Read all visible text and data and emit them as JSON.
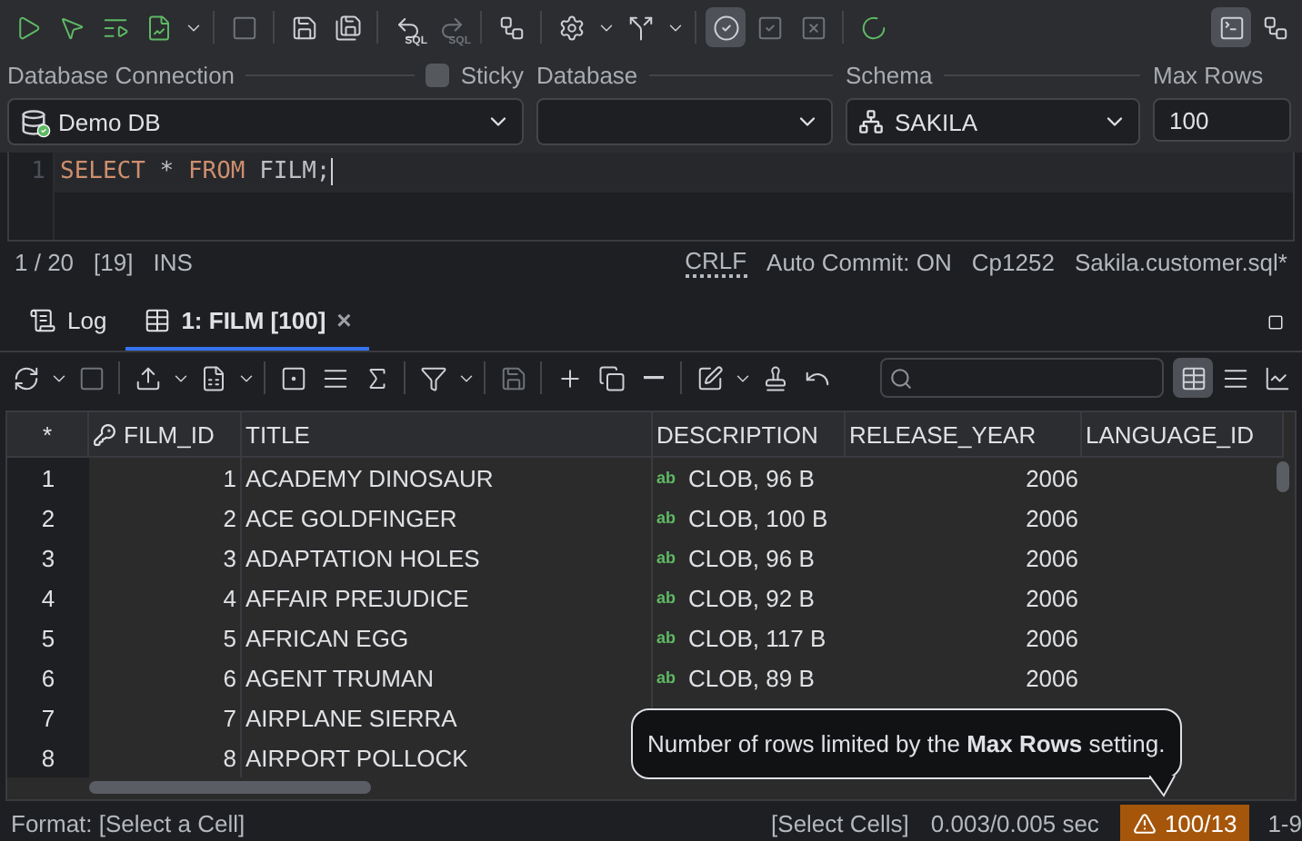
{
  "main_toolbar": [
    {
      "kind": "run",
      "selected": false,
      "disabled": false
    },
    {
      "kind": "runcursor",
      "selected": false,
      "disabled": false
    },
    {
      "kind": "runscript",
      "selected": false,
      "disabled": false
    },
    {
      "kind": "runplan",
      "selected": false,
      "disabled": false
    },
    {
      "kind": "dropdown",
      "selected": false,
      "disabled": false
    },
    {
      "kind": "sep"
    },
    {
      "kind": "stop",
      "selected": false,
      "disabled": true
    },
    {
      "kind": "sep"
    },
    {
      "kind": "save",
      "selected": false,
      "disabled": false
    },
    {
      "kind": "saveall",
      "selected": false,
      "disabled": false
    },
    {
      "kind": "sep"
    },
    {
      "kind": "undosql",
      "label": "SQL",
      "selected": false,
      "disabled": false
    },
    {
      "kind": "redosql",
      "label": "SQL",
      "selected": false,
      "disabled": true
    },
    {
      "kind": "sep"
    },
    {
      "kind": "diagram",
      "selected": false,
      "disabled": false
    },
    {
      "kind": "sep"
    },
    {
      "kind": "settings",
      "selected": false,
      "disabled": false
    },
    {
      "kind": "dropdown",
      "selected": false,
      "disabled": false
    },
    {
      "kind": "branch",
      "selected": false,
      "disabled": false
    },
    {
      "kind": "dropdown",
      "selected": false,
      "disabled": false
    },
    {
      "kind": "sep"
    },
    {
      "kind": "autocommit",
      "selected": true,
      "disabled": false
    },
    {
      "kind": "commit",
      "selected": false,
      "disabled": true
    },
    {
      "kind": "rollback",
      "selected": false,
      "disabled": true
    },
    {
      "kind": "sep"
    },
    {
      "kind": "spinner",
      "selected": false,
      "disabled": false
    }
  ],
  "toolbar_right": [
    {
      "kind": "terminal",
      "selected": true,
      "disabled": false
    },
    {
      "kind": "diagram",
      "selected": false,
      "disabled": false
    }
  ],
  "connection_bar": {
    "connection": {
      "label": "Database Connection",
      "value": "Demo DB"
    },
    "sticky": {
      "label": "Sticky",
      "checked": false
    },
    "database": {
      "label": "Database"
    },
    "schema": {
      "label": "Schema",
      "value": "SAKILA"
    },
    "max_rows": {
      "label": "Max Rows",
      "value": "100"
    }
  },
  "editor": {
    "lines": [
      {
        "number": "1",
        "tokens": [
          {
            "kind": "keyword",
            "text": "SELECT"
          },
          {
            "kind": "plain",
            "text": " * "
          },
          {
            "kind": "keyword",
            "text": "FROM"
          },
          {
            "kind": "plain",
            "text": " FILM;"
          }
        ]
      }
    ]
  },
  "editor_status": {
    "position": "1 / 20",
    "offset": "[19]",
    "mode": "INS",
    "line_ending": "CRLF",
    "auto_commit": "Auto Commit: ON",
    "encoding": "Cp1252",
    "file": "Sakila.customer.sql*"
  },
  "result_tabs": [
    {
      "kind": "log",
      "label": "Log",
      "selected": false
    },
    {
      "kind": "grid",
      "label": "1: FILM [100]",
      "selected": true,
      "close": "×"
    }
  ],
  "result_toolbar": [
    {
      "kind": "refresh",
      "disabled": false
    },
    {
      "kind": "dropdown",
      "disabled": false
    },
    {
      "kind": "stop",
      "disabled": true
    },
    {
      "kind": "sep"
    },
    {
      "kind": "export",
      "disabled": false
    },
    {
      "kind": "dropdown",
      "disabled": false
    },
    {
      "kind": "sheet",
      "disabled": false
    },
    {
      "kind": "dropdown",
      "disabled": false
    },
    {
      "kind": "sep"
    },
    {
      "kind": "single",
      "disabled": false
    },
    {
      "kind": "text",
      "disabled": false
    },
    {
      "kind": "sum",
      "disabled": false
    },
    {
      "kind": "sep"
    },
    {
      "kind": "filter",
      "disabled": false
    },
    {
      "kind": "dropdown",
      "disabled": false
    },
    {
      "kind": "sep"
    },
    {
      "kind": "save",
      "disabled": true
    },
    {
      "kind": "sep"
    },
    {
      "kind": "add",
      "disabled": false
    },
    {
      "kind": "copy",
      "disabled": false
    },
    {
      "kind": "remove",
      "disabled": false
    },
    {
      "kind": "sep"
    },
    {
      "kind": "edit",
      "disabled": false
    },
    {
      "kind": "dropdown",
      "disabled": false
    },
    {
      "kind": "stamp",
      "disabled": false
    },
    {
      "kind": "revert",
      "disabled": false
    }
  ],
  "result_view_modes": [
    {
      "kind": "grid",
      "selected": true
    },
    {
      "kind": "text",
      "selected": false
    },
    {
      "kind": "chart",
      "selected": false
    }
  ],
  "table": {
    "columns": [
      {
        "label": "*",
        "key": false
      },
      {
        "label": "FILM_ID",
        "key": true
      },
      {
        "label": "TITLE",
        "key": false
      },
      {
        "label": "DESCRIPTION",
        "key": false
      },
      {
        "label": "RELEASE_YEAR",
        "key": false
      },
      {
        "label": "LANGUAGE_ID",
        "key": false
      }
    ],
    "rows": [
      {
        "number": "1",
        "film_id": "1",
        "title": "ACADEMY DINOSAUR",
        "description": {
          "badge": "ab",
          "text": "CLOB, 96 B"
        },
        "release_year": "2006"
      },
      {
        "number": "2",
        "film_id": "2",
        "title": "ACE GOLDFINGER",
        "description": {
          "badge": "ab",
          "text": "CLOB, 100 B"
        },
        "release_year": "2006"
      },
      {
        "number": "3",
        "film_id": "3",
        "title": "ADAPTATION HOLES",
        "description": {
          "badge": "ab",
          "text": "CLOB, 96 B"
        },
        "release_year": "2006"
      },
      {
        "number": "4",
        "film_id": "4",
        "title": "AFFAIR PREJUDICE",
        "description": {
          "badge": "ab",
          "text": "CLOB, 92 B"
        },
        "release_year": "2006"
      },
      {
        "number": "5",
        "film_id": "5",
        "title": "AFRICAN EGG",
        "description": {
          "badge": "ab",
          "text": "CLOB, 117 B"
        },
        "release_year": "2006"
      },
      {
        "number": "6",
        "film_id": "6",
        "title": "AGENT TRUMAN",
        "description": {
          "badge": "ab",
          "text": "CLOB, 89 B"
        },
        "release_year": "2006"
      },
      {
        "number": "7",
        "film_id": "7",
        "title": "AIRPLANE SIERRA"
      },
      {
        "number": "8",
        "film_id": "8",
        "title": "AIRPORT POLLOCK"
      }
    ]
  },
  "tooltip": {
    "text": "Number of rows limited by the **Max Rows** setting."
  },
  "status_bar": {
    "format": "Format: [Select a Cell]",
    "selection": "[Select Cells]",
    "timing": "0.003/0.005 sec",
    "row_limit_warning": "100/13",
    "range": "1-9"
  }
}
